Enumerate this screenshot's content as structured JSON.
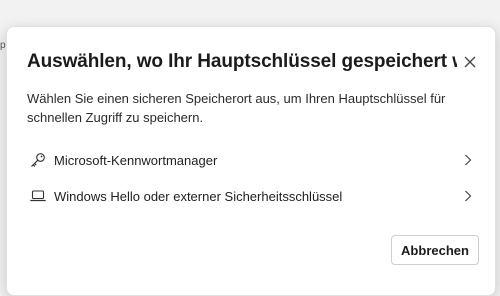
{
  "background": {
    "glyph": "p"
  },
  "dialog": {
    "title": "Auswählen, wo Ihr Hauptschlüssel gespeichert we...",
    "description": "Wählen Sie einen sicheren Speicherort aus, um Ihren Hauptschlüssel für schnellen Zugriff zu speichern.",
    "options": [
      {
        "label": "Microsoft-Kennwortmanager",
        "icon": "key-icon"
      },
      {
        "label": "Windows Hello oder externer Sicherheitsschlüssel",
        "icon": "laptop-icon"
      }
    ],
    "cancel_label": "Abbrechen"
  },
  "colors": {
    "dialog_bg": "#ffffff",
    "text": "#1b1b1b",
    "border": "#cfcfcf"
  }
}
